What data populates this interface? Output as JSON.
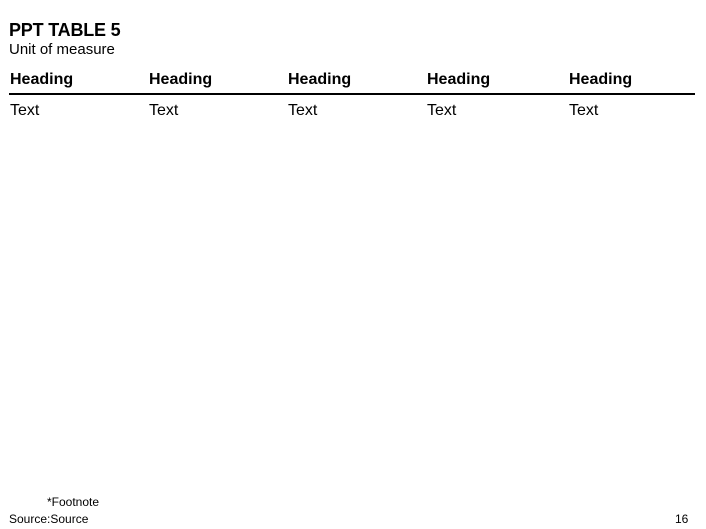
{
  "slide": {
    "title": "PPT TABLE 5",
    "subtitle": "Unit of measure",
    "page_number": "16"
  },
  "table": {
    "headers": [
      "Heading",
      "Heading",
      "Heading",
      "Heading",
      "Heading"
    ],
    "rows": [
      [
        "Text",
        "Text",
        "Text",
        "Text",
        "Text"
      ]
    ]
  },
  "footer": {
    "footnote": "*Footnote",
    "source": "Source:Source"
  }
}
